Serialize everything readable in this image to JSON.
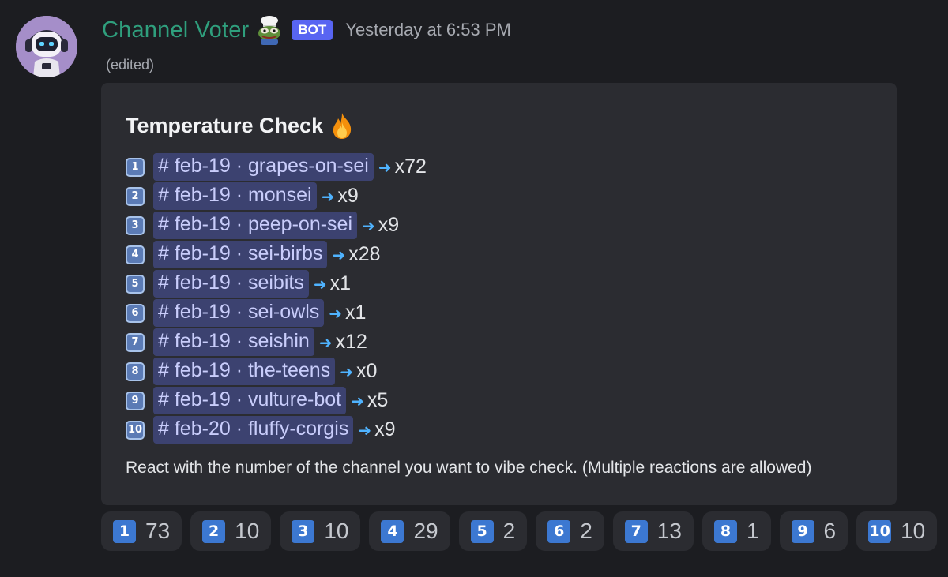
{
  "message": {
    "username": "Channel Voter",
    "bot_tag": "BOT",
    "timestamp": "Yesterday at 6:53 PM",
    "edited": "(edited)"
  },
  "embed": {
    "title": "Temperature Check",
    "rows": [
      {
        "num": "1",
        "date": "feb-19",
        "channel": "grapes-on-sei",
        "count": "x72"
      },
      {
        "num": "2",
        "date": "feb-19",
        "channel": "monsei",
        "count": "x9"
      },
      {
        "num": "3",
        "date": "feb-19",
        "channel": "peep-on-sei",
        "count": "x9"
      },
      {
        "num": "4",
        "date": "feb-19",
        "channel": "sei-birbs",
        "count": "x28"
      },
      {
        "num": "5",
        "date": "feb-19",
        "channel": "seibits",
        "count": "x1"
      },
      {
        "num": "6",
        "date": "feb-19",
        "channel": "sei-owls",
        "count": "x1"
      },
      {
        "num": "7",
        "date": "feb-19",
        "channel": "seishin",
        "count": "x12"
      },
      {
        "num": "8",
        "date": "feb-19",
        "channel": "the-teens",
        "count": "x0"
      },
      {
        "num": "9",
        "date": "feb-19",
        "channel": "vulture-bot",
        "count": "x5"
      },
      {
        "num": "10",
        "date": "feb-20",
        "channel": "fluffy-corgis",
        "count": "x9"
      }
    ],
    "footer": "React with the number of the channel you want to vibe check. (Multiple reactions are allowed)"
  },
  "reactions": [
    {
      "emoji": "1",
      "count": "73"
    },
    {
      "emoji": "2",
      "count": "10"
    },
    {
      "emoji": "3",
      "count": "10"
    },
    {
      "emoji": "4",
      "count": "29"
    },
    {
      "emoji": "5",
      "count": "2"
    },
    {
      "emoji": "6",
      "count": "2"
    },
    {
      "emoji": "7",
      "count": "13"
    },
    {
      "emoji": "8",
      "count": "1"
    },
    {
      "emoji": "9",
      "count": "6"
    },
    {
      "emoji": "10",
      "count": "10"
    }
  ],
  "colors": {
    "background": "#1c1d21",
    "embed_bg": "#2b2c31",
    "username": "#2f9f7d",
    "bot_tag": "#5865f2",
    "mention_bg": "#3c4270",
    "mention_text": "#c9cdfb",
    "arrow": "#4fb3ff",
    "keycap": "#3c78d1"
  },
  "icons": {
    "avatar": "robot-avatar",
    "name_emoji": "pepe-chef-icon",
    "title_emoji": "fire-icon",
    "arrow": "right-arrow-icon"
  }
}
